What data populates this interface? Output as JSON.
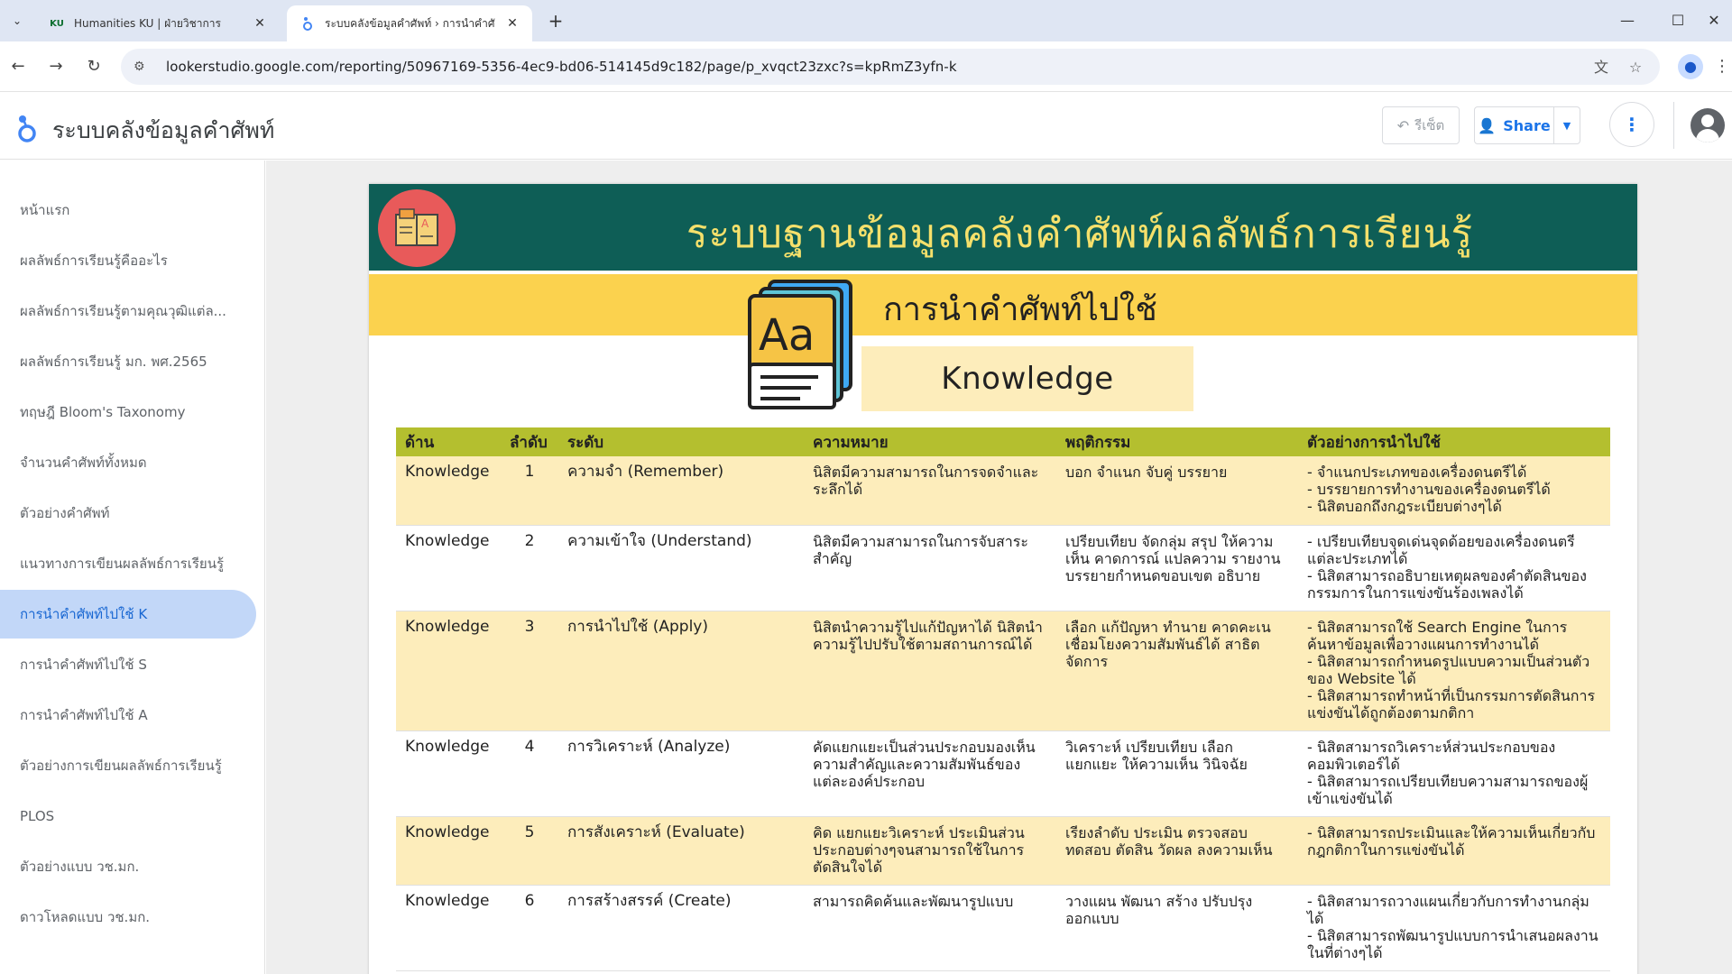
{
  "browser": {
    "tabs": [
      {
        "favicon": "KU",
        "title": "Humanities KU | ฝ่ายวิชาการ",
        "active": false
      },
      {
        "favicon": "looker-studio-icon",
        "title": "ระบบคลังข้อมูลคำศัพท์ › การนำคำศั",
        "active": true
      }
    ],
    "url": "lookerstudio.google.com/reporting/50967169-5356-4ec9-bd06-514145d9c182/page/p_xvqct23zxc?s=kpRmZ3yfn-k"
  },
  "app": {
    "title": "ระบบคลังข้อมูลคำศัพท์",
    "reset_label": "รีเซ็ต",
    "share_label": "Share"
  },
  "sidebar": {
    "items": [
      {
        "label": "หน้าแรก",
        "active": false
      },
      {
        "label": "ผลลัพธ์การเรียนรู้คืออะไร",
        "active": false
      },
      {
        "label": "ผลลัพธ์การเรียนรู้ตามคุณวุฒิแต่ล...",
        "active": false
      },
      {
        "label": "ผลลัพธ์การเรียนรู้ มก. พศ.2565",
        "active": false
      },
      {
        "label": "ทฤษฎี Bloom's Taxonomy",
        "active": false
      },
      {
        "label": "จำนวนคำศัพท์ทั้งหมด",
        "active": false
      },
      {
        "label": "ตัวอย่างคำศัพท์",
        "active": false
      },
      {
        "label": "แนวทางการเขียนผลลัพธ์การเรียนรู้",
        "active": false
      },
      {
        "label": "การนำคำศัพท์ไปใช้ K",
        "active": true
      },
      {
        "label": "การนำคำศัพท์ไปใช้ S",
        "active": false
      },
      {
        "label": "การนำคำศัพท์ไปใช้ A",
        "active": false
      },
      {
        "label": "ตัวอย่างการเขียนผลลัพธ์การเรียนรู้",
        "active": false
      },
      {
        "label": "PLOS",
        "active": false
      },
      {
        "label": "ตัวอย่างแบบ วช.มก.",
        "active": false
      },
      {
        "label": "ดาวโหลดแบบ วช.มก.",
        "active": false
      }
    ]
  },
  "report": {
    "banner_title": "ระบบฐานข้อมูลคลังคำศัพท์ผลลัพธ์การเรียนรู้",
    "section_title": "การนำคำศัพท์ไปใช้",
    "domain_label": "Knowledge",
    "colors": {
      "banner": "#0e5e56",
      "banner_text": "#f5e06b",
      "strip": "#fbd24e",
      "table_header": "#b4bf2f",
      "row_alt": "#fdedbb"
    },
    "table": {
      "headers": [
        "ด้าน",
        "ลำดับ",
        "ระดับ",
        "ความหมาย",
        "พฤติกรรม",
        "ตัวอย่างการนำไปใช้"
      ],
      "rows": [
        {
          "domain": "Knowledge",
          "order": "1",
          "level": "ความจำ (Remember)",
          "meaning": "นิสิตมีความสามารถในการจดจำและระลึกได้",
          "behavior": "บอก จำแนก จับคู่ บรรยาย",
          "examples": [
            "- จำแนกประเภทของเครื่องดนตรีได้",
            "- บรรยายการทำงานของเครื่องดนตรีได้",
            "- นิสิตบอกถึงกฎระเบียบต่างๆได้"
          ]
        },
        {
          "domain": "Knowledge",
          "order": "2",
          "level": "ความเข้าใจ (Understand)",
          "meaning": "นิสิตมีความสามารถในการจับสาระสำคัญ",
          "behavior": "เปรียบเทียบ จัดกลุ่ม สรุป ให้ความเห็น คาดการณ์ แปลความ รายงาน บรรยายกำหนดขอบเขต อธิบาย",
          "examples": [
            "- เปรียบเทียบจุดเด่นจุดด้อยของเครื่องดนตรีแต่ละประเภทได้",
            "- นิสิตสามารถอธิบายเหตุผลของคำตัดสินของกรรมการในการแข่งขันร้องเพลงได้"
          ]
        },
        {
          "domain": "Knowledge",
          "order": "3",
          "level": "การนำไปใช้ (Apply)",
          "meaning": "นิสิตนำความรู้ไปแก้ปัญหาได้ นิสิตนำความรู้ไปปรับใช้ตามสถานการณ์ได้",
          "behavior": "เลือก แก้ปัญหา ทำนาย คาดคะเน เชื่อมโยงความสัมพันธ์ได้ สาธิต จัดการ",
          "examples": [
            "- นิสิตสามารถใช้ Search Engine ในการค้นหาข้อมูลเพื่อวางแผนการทำงานได้",
            "- นิสิตสามารถกำหนดรูปแบบความเป็นส่วนตัวของ Website ได้",
            "- นิสิตสามารถทำหน้าที่เป็นกรรมการตัดสินการแข่งขันได้ถูกต้องตามกติกา"
          ]
        },
        {
          "domain": "Knowledge",
          "order": "4",
          "level": "การวิเคราะห์ (Analyze)",
          "meaning": "คัดแยกแยะเป็นส่วนประกอบมองเห็นความสำคัญและความสัมพันธ์ของแต่ละองค์ประกอบ",
          "behavior": "วิเคราะห์ เปรียบเทียบ เลือก แยกแยะ ให้ความเห็น วินิจฉัย",
          "examples": [
            "- นิสิตสามารถวิเคราะห์ส่วนประกอบของคอมพิวเตอร์ได้",
            "- นิสิตสามารถเปรียบเทียบความสามารถของผู้เข้าแข่งขันได้"
          ]
        },
        {
          "domain": "Knowledge",
          "order": "5",
          "level": "การสังเคราะห์ (Evaluate)",
          "meaning": "คิด แยกแยะวิเคราะห์ ประเมินส่วนประกอบต่างๆจนสามารถใช้ในการตัดสินใจได้",
          "behavior": "เรียงลำดับ ประเมิน ตรวจสอบ ทดสอบ ตัดสิน วัดผล ลงความเห็น",
          "examples": [
            "- นิสิตสามารถประเมินและให้ความเห็นเกี่ยวกับกฎกติกาในการแข่งขันได้"
          ]
        },
        {
          "domain": "Knowledge",
          "order": "6",
          "level": "การสร้างสรรค์ (Create)",
          "meaning": "สามารถคิดค้นและพัฒนารูปแบบ",
          "behavior": "วางแผน พัฒนา สร้าง ปรับปรุง ออกแบบ",
          "examples": [
            "- นิสิตสามารถวางแผนเกี่ยวกับการทำงานกลุ่มได้",
            "- นิสิตสามารถพัฒนารูปแบบการนำเสนอผลงานในที่ต่างๆได้"
          ]
        }
      ]
    }
  }
}
